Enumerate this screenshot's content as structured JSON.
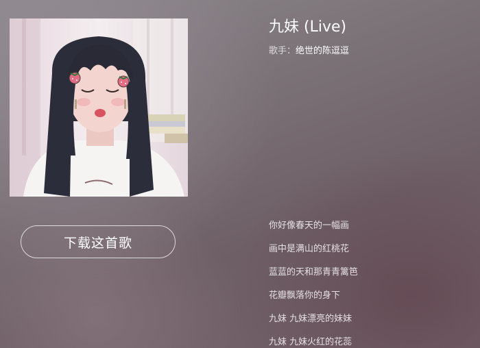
{
  "album": {
    "cover_description_icon": "album-cover-image"
  },
  "song": {
    "title": "九妹 (Live)",
    "artist_label": "歌手：",
    "artist_name": "绝世的陈逗逗"
  },
  "actions": {
    "download_label": "下载这首歌"
  },
  "lyrics": [
    "你好像春天的一幅画",
    "画中是满山的红桃花",
    "蓝蓝的天和那青青篱笆",
    "花瓣飘落你的身下",
    "九妹 九妹漂亮的妹妹",
    "九妹 九妹火红的花蕊"
  ],
  "colors": {
    "text_primary": "#ffffff",
    "background_top": "#8c878c",
    "background_bottom": "#73616a"
  }
}
